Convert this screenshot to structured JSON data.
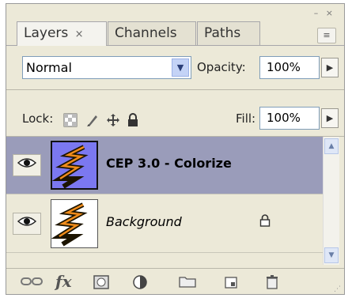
{
  "tabs": [
    {
      "label": "Layers",
      "close": "×",
      "active": true
    },
    {
      "label": "Channels",
      "active": false
    },
    {
      "label": "Paths",
      "active": false
    }
  ],
  "window_controls": {
    "minimize": "–",
    "close": "×"
  },
  "panel_menu_icon": "≡",
  "blend_mode": {
    "value": "Normal"
  },
  "opacity": {
    "label": "Opacity:",
    "value": "100%"
  },
  "lock": {
    "label": "Lock:"
  },
  "fill": {
    "label": "Fill:",
    "value": "100%"
  },
  "layers": [
    {
      "name": "CEP 3.0 - Colorize",
      "selected": true,
      "visible": true,
      "locked": false
    },
    {
      "name": "Background",
      "selected": false,
      "visible": true,
      "locked": true
    }
  ],
  "colors": {
    "selected_row": "#9a9cba",
    "panel_bg": "#ece9d8",
    "thumb_bg_selected": "#7b78f0"
  }
}
